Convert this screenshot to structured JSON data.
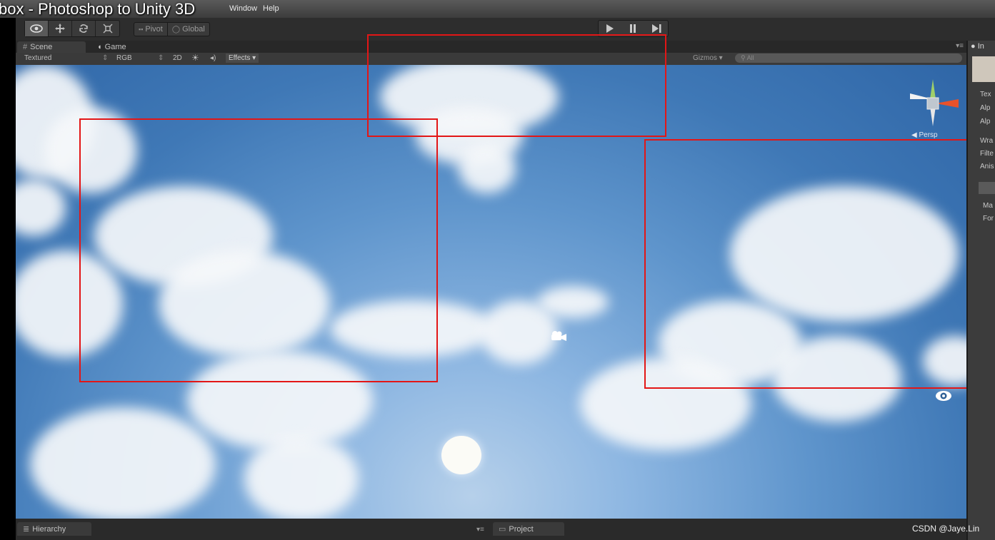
{
  "video_title": "box - Photoshop to Unity 3D",
  "menu": {
    "window": "Window",
    "help": "Help"
  },
  "toolbar": {
    "tools": [
      "view-eye-icon",
      "move-icon",
      "rotate-icon",
      "scale-icon"
    ],
    "pivot_label": "Pivot",
    "global_label": "Global"
  },
  "tabs": {
    "scene": "Scene",
    "game": "Game"
  },
  "scene_toolbar": {
    "draw_mode": "Textured",
    "render_mode": "RGB",
    "mode_2d": "2D",
    "effects": "Effects",
    "gizmos": "Gizmos",
    "search_placeholder": "All"
  },
  "viewport": {
    "persp_label": "Persp",
    "sky_colors": {
      "horizon": "#b6d0ea",
      "zenith": "#2f66a7"
    },
    "annotation_color": "#e31616"
  },
  "inspector": {
    "tab_label": "In",
    "rows": [
      "Tex",
      "Alp",
      "Alp",
      "Wra",
      "Filte",
      "Anis",
      "Ma",
      "For"
    ]
  },
  "bottom": {
    "hierarchy": "Hierarchy",
    "project": "Project"
  },
  "watermark": "CSDN @Jaye.Lin"
}
